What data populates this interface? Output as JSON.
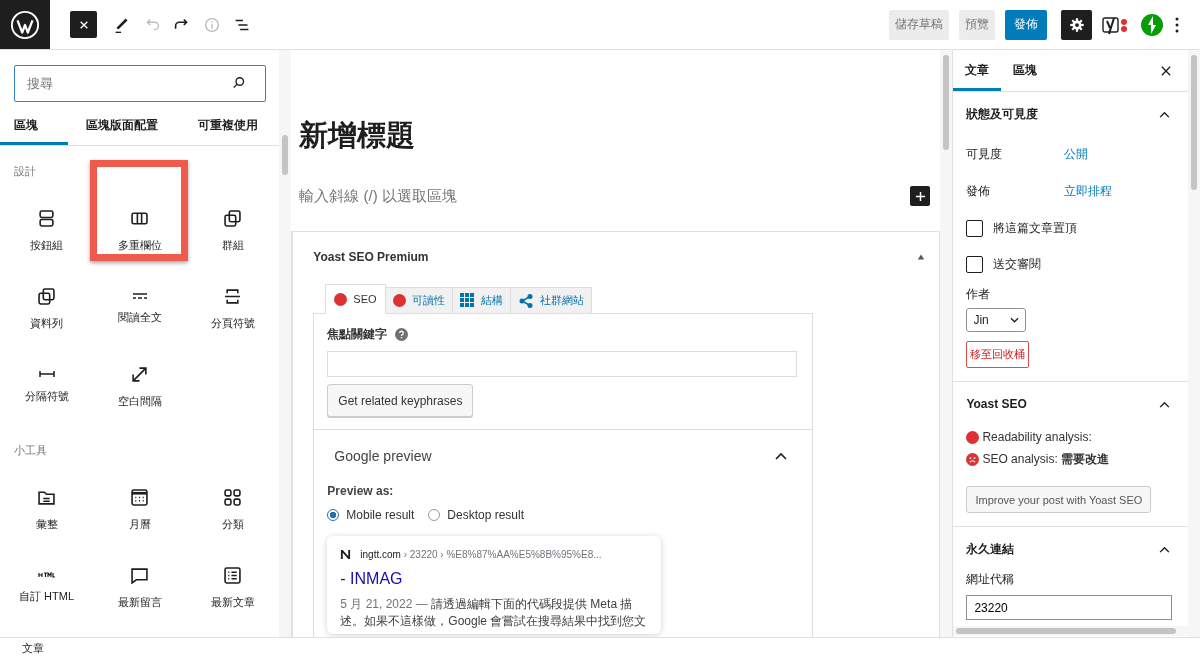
{
  "toolbar": {
    "undo_disabled": true,
    "info_disabled": true,
    "settings_active": true
  },
  "actions": {
    "save_draft": "儲存草稿",
    "preview": "預覽",
    "publish": "發佈"
  },
  "inserter": {
    "search": {
      "placeholder": "搜尋"
    },
    "tabs": [
      {
        "label": "區塊",
        "selected": true
      },
      {
        "label": "區塊版面配置",
        "selected": false
      },
      {
        "label": "可重複使用",
        "selected": false
      }
    ],
    "sections": [
      {
        "title": "設計",
        "items": [
          {
            "label": "按鈕組",
            "kind": "buttons",
            "highlighted": false
          },
          {
            "label": "多重欄位",
            "kind": "columns",
            "highlighted": true
          },
          {
            "label": "群組",
            "kind": "group",
            "highlighted": false
          },
          {
            "label": "資料列",
            "kind": "group",
            "highlighted": false
          },
          {
            "label": "閱讀全文",
            "kind": "more",
            "highlighted": false
          },
          {
            "label": "分頁符號",
            "kind": "pagebreak",
            "highlighted": false
          },
          {
            "label": "分隔符號",
            "kind": "separator",
            "highlighted": false
          },
          {
            "label": "空白間隔",
            "kind": "spacer",
            "highlighted": false
          }
        ]
      },
      {
        "title": "小工具",
        "items": [
          {
            "label": "彙整",
            "kind": "archive",
            "highlighted": false
          },
          {
            "label": "月曆",
            "kind": "calendar",
            "highlighted": false
          },
          {
            "label": "分類",
            "kind": "categories",
            "highlighted": false
          },
          {
            "label": "自訂 HTML",
            "kind": "html",
            "highlighted": false
          },
          {
            "label": "最新留言",
            "kind": "comment",
            "highlighted": false
          },
          {
            "label": "最新文章",
            "kind": "posts",
            "highlighted": false
          }
        ]
      }
    ]
  },
  "editor": {
    "title_placeholder": "新增標題",
    "block_placeholder": "輸入斜線 (/) 以選取區塊"
  },
  "yoast_panel": {
    "title": "Yoast SEO Premium",
    "expanded": true,
    "tabs": [
      {
        "label": "SEO",
        "kind": "dot",
        "color": "#dc3232",
        "selected": true
      },
      {
        "label": "可讀性",
        "kind": "dot",
        "color": "#dc3232",
        "selected": false
      },
      {
        "label": "結構",
        "kind": "grid",
        "selected": false
      },
      {
        "label": "社群網站",
        "kind": "share",
        "selected": false
      }
    ],
    "focus_keyphrase": {
      "label": "焦點關鍵字"
    },
    "related_button": "Get related keyphrases",
    "google_preview": {
      "title": "Google preview",
      "expanded": true,
      "preview_as": "Preview as:",
      "options": [
        {
          "label": "Mobile result",
          "selected": true
        },
        {
          "label": "Desktop result",
          "selected": false
        }
      ],
      "snippet": {
        "site": "ingtt.com",
        "path": "› 23220 › %E8%87%AA%E5%8B%95%E8...",
        "title": "- INMAG",
        "date": "5 月 21, 2022 —",
        "description": "請透過編輯下面的代碼段提供 Meta 描述。如果不這樣做，Google 會嘗試在搜尋結果中找到您文"
      }
    }
  },
  "sidebar": {
    "tabs": [
      {
        "label": "文章",
        "selected": true
      },
      {
        "label": "區塊",
        "selected": false
      }
    ],
    "status": {
      "title": "狀態及可見度",
      "expanded": true,
      "rows": [
        {
          "label": "可見度",
          "value": "公開"
        },
        {
          "label": "發佈",
          "value": "立即排程"
        }
      ],
      "checkboxes": [
        {
          "label": "將這篇文章置頂",
          "checked": false
        },
        {
          "label": "送交審閱",
          "checked": false
        }
      ],
      "author_label": "作者",
      "author": "Jin",
      "trash": "移至回收桶"
    },
    "yoast": {
      "title": "Yoast SEO",
      "expanded": true,
      "analyses": [
        {
          "label": "Readability analysis:",
          "kind": "dot",
          "color": "#dc3232"
        },
        {
          "label": "SEO analysis: **需要改進**",
          "kind": "sad",
          "color": "#dc3232"
        }
      ],
      "button": "Improve your post with Yoast SEO"
    },
    "permalink": {
      "title": "永久連結",
      "expanded": true,
      "slug_label": "網址代稱",
      "slug": "23220"
    }
  },
  "footer": {
    "breadcrumb": "文章"
  }
}
